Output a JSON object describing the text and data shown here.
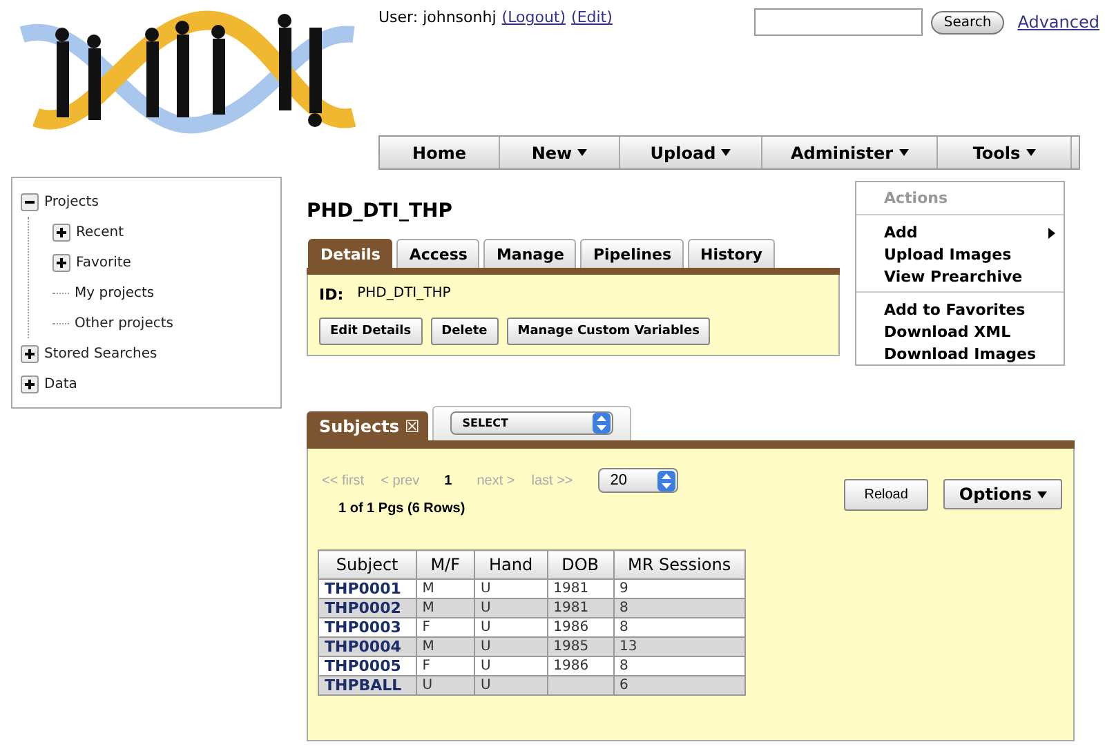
{
  "user": {
    "label": "User:",
    "name": "johnsonhj",
    "links": [
      "(Logout)",
      "(Edit)"
    ]
  },
  "search": {
    "button": "Search",
    "link": "Advanced"
  },
  "nav": [
    {
      "label": "Home",
      "dropdown": false
    },
    {
      "label": "New",
      "dropdown": true
    },
    {
      "label": "Upload",
      "dropdown": true
    },
    {
      "label": "Administer",
      "dropdown": true
    },
    {
      "label": "Tools",
      "dropdown": true
    }
  ],
  "tree": [
    {
      "label": "Projects",
      "expanded": true,
      "children": [
        {
          "label": "Recent",
          "expanded": false
        },
        {
          "label": "Favorite",
          "expanded": false
        },
        {
          "label": "My projects"
        },
        {
          "label": "Other projects"
        }
      ]
    },
    {
      "label": "Stored Searches",
      "expanded": false
    },
    {
      "label": "Data",
      "expanded": false
    }
  ],
  "project": {
    "title": "PHD_DTI_THP",
    "tabs": [
      {
        "label": "Details",
        "selected": true
      },
      {
        "label": "Access",
        "selected": false
      },
      {
        "label": "Manage",
        "selected": false
      },
      {
        "label": "Pipelines",
        "selected": false
      },
      {
        "label": "History",
        "selected": false
      }
    ],
    "id_label": "ID:",
    "id_value": "PHD_DTI_THP",
    "buttons": [
      "Edit Details",
      "Delete",
      "Manage Custom Variables"
    ]
  },
  "actions": {
    "title": "Actions",
    "groups": [
      [
        {
          "label": "Add",
          "submenu": true
        },
        {
          "label": "Upload Images",
          "submenu": false
        },
        {
          "label": "View Prearchive",
          "submenu": false
        }
      ],
      [
        {
          "label": "Add to Favorites",
          "submenu": false
        },
        {
          "label": "Download XML",
          "submenu": false
        },
        {
          "label": "Download Images",
          "submenu": false
        }
      ]
    ]
  },
  "subjects": {
    "tab": "Subjects",
    "close": "☒",
    "select": "SELECT",
    "pager": [
      {
        "label": "<< first",
        "current": false
      },
      {
        "label": "< prev",
        "current": false
      },
      {
        "label": "1",
        "current": true
      },
      {
        "label": "next >",
        "current": false
      },
      {
        "label": "last >>",
        "current": false
      }
    ],
    "page_size": "20",
    "summary": "1 of 1 Pgs (6 Rows)",
    "reload": "Reload",
    "options": "Options",
    "columns": [
      "Subject",
      "M/F",
      "Hand",
      "DOB",
      "MR Sessions"
    ],
    "rows": [
      [
        "THP0001",
        "M",
        "U",
        "1981",
        "9"
      ],
      [
        "THP0002",
        "M",
        "U",
        "1981",
        "8"
      ],
      [
        "THP0003",
        "F",
        "U",
        "1986",
        "8"
      ],
      [
        "THP0004",
        "M",
        "U",
        "1985",
        "13"
      ],
      [
        "THP0005",
        "F",
        "U",
        "1986",
        "8"
      ],
      [
        "THPBALL",
        "U",
        "U",
        "",
        "6"
      ]
    ]
  }
}
